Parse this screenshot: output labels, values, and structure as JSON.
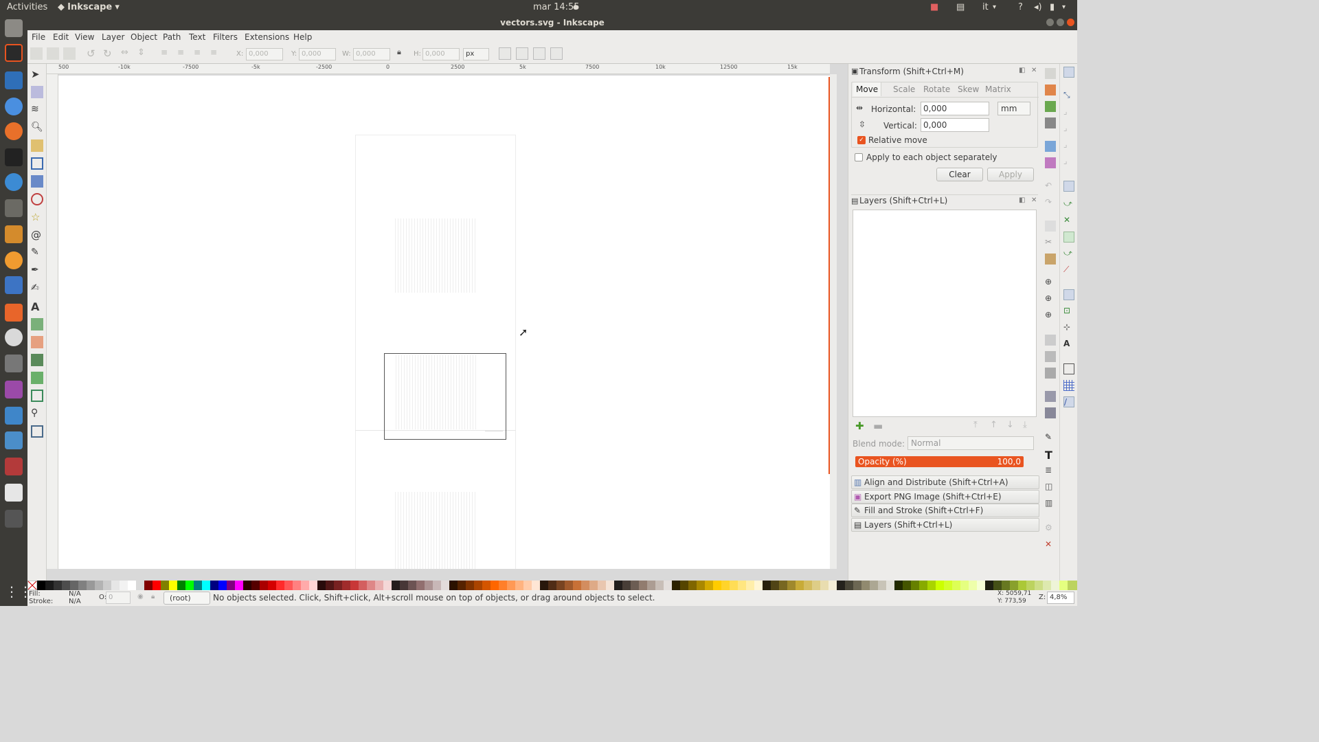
{
  "topbar": {
    "activities": "Activities",
    "app": "Inkscape",
    "clock": "mar 14:55",
    "lang": "it",
    "help": "?"
  },
  "window": {
    "title": "vectors.svg - Inkscape"
  },
  "menu": [
    "File",
    "Edit",
    "View",
    "Layer",
    "Object",
    "Path",
    "Text",
    "Filters",
    "Extensions",
    "Help"
  ],
  "toolbar": {
    "x_label": "X:",
    "x_value": "0,000",
    "y_label": "Y:",
    "y_value": "0,000",
    "w_label": "W:",
    "w_value": "0,000",
    "h_label": "H:",
    "h_value": "0,000",
    "unit": "px"
  },
  "ruler": {
    "h_ticks": [
      "-10k",
      "-7500",
      "-5k",
      "-2500",
      "0",
      "2500",
      "5k",
      "7500",
      "10k",
      "12500",
      "15k"
    ],
    "h_start": "500"
  },
  "transform": {
    "title": "Transform (Shift+Ctrl+M)",
    "tabs": [
      "Move",
      "Scale",
      "Rotate",
      "Skew",
      "Matrix"
    ],
    "horizontal_label": "Horizontal:",
    "horizontal_value": "0,000",
    "unit": "mm",
    "vertical_label": "Vertical:",
    "vertical_value": "0,000",
    "relative_move": "Relative move",
    "relative_checked": true,
    "apply_each": "Apply to each object separately",
    "apply_each_checked": false,
    "clear": "Clear",
    "apply": "Apply"
  },
  "layers": {
    "title": "Layers (Shift+Ctrl+L)",
    "blend_label": "Blend mode:",
    "blend_value": "Normal",
    "opacity_label": "Opacity (%)",
    "opacity_value": "100,0"
  },
  "docked": [
    {
      "label": "Align and Distribute (Shift+Ctrl+A)"
    },
    {
      "label": "Export PNG Image (Shift+Ctrl+E)"
    },
    {
      "label": "Fill and Stroke (Shift+Ctrl+F)"
    },
    {
      "label": "Layers (Shift+Ctrl+L)"
    }
  ],
  "status": {
    "fill_label": "Fill:",
    "fill_value": "N/A",
    "stroke_label": "Stroke:",
    "stroke_value": "N/A",
    "opacity_label": "O:",
    "opacity_value": "0",
    "layer": "(root)",
    "message": "No objects selected. Click, Shift+click, Alt+scroll mouse on top of objects, or drag around objects to select.",
    "x_coord": "X: 5059,71",
    "y_coord": "Y: 773,59",
    "zoom_label": "Z:",
    "zoom": "4,8%"
  },
  "colors": {
    "accent": "#e95420",
    "chrome": "#3c3b37",
    "panel": "#edecea"
  }
}
